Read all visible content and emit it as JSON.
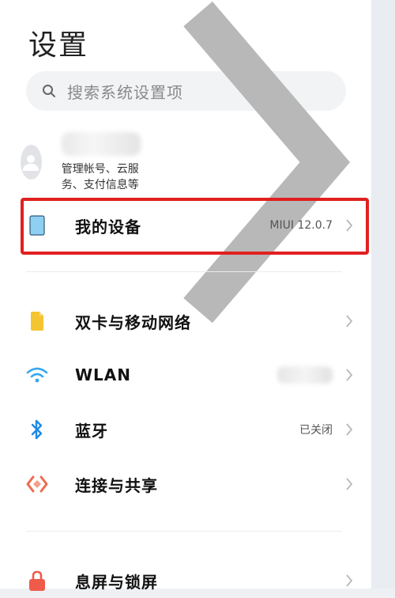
{
  "header": {
    "title": "设置"
  },
  "search": {
    "placeholder": "搜索系统设置项"
  },
  "account": {
    "subtitle": "管理帐号、云服务、支付信息等"
  },
  "items": [
    {
      "label": "我的设备",
      "value": "MIUI 12.0.7",
      "icon": "tablet-icon"
    },
    {
      "label": "双卡与移动网络",
      "value": "",
      "icon": "sim-card-icon"
    },
    {
      "label": "WLAN",
      "value": "",
      "icon": "wifi-icon"
    },
    {
      "label": "蓝牙",
      "value": "已关闭",
      "icon": "bluetooth-icon"
    },
    {
      "label": "连接与共享",
      "value": "",
      "icon": "share-icon"
    },
    {
      "label": "息屏与锁屏",
      "value": "",
      "icon": "lock-icon"
    }
  ],
  "colors": {
    "highlight": "#e02020",
    "sim": "#f5c431",
    "wifi": "#3aa6f0",
    "bluetooth": "#1e88e5",
    "share": "#ef6b4f",
    "lock": "#ef5a4a",
    "tablet": "#8fd0f2"
  }
}
